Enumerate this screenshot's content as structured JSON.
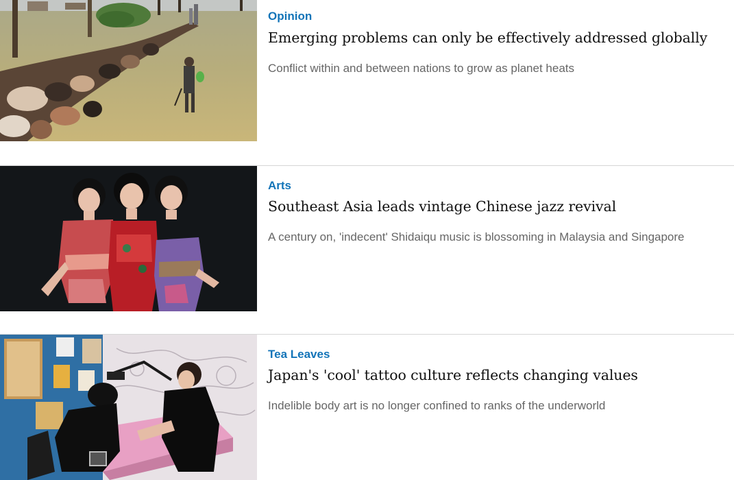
{
  "articles": [
    {
      "category": "Opinion",
      "headline": "Emerging problems can only be effectively addressed globally",
      "summary": "Conflict within and between nations to grow as planet heats"
    },
    {
      "category": "Arts",
      "headline": "Southeast Asia leads vintage Chinese jazz revival",
      "summary": "A century on, 'indecent' Shidaiqu music is blossoming in Malaysia and Singapore"
    },
    {
      "category": "Tea Leaves",
      "headline": "Japan's 'cool' tattoo culture reflects changing values",
      "summary": "Indelible body art is no longer confined to ranks of the underworld"
    }
  ],
  "colors": {
    "category": "#1374b8",
    "headline": "#111111",
    "summary": "#666666",
    "divider": "#d6d6d6"
  },
  "images": [
    "flooded-field-cattle-herder-photo",
    "three-women-singers-photo",
    "tattoo-studio-photo"
  ]
}
